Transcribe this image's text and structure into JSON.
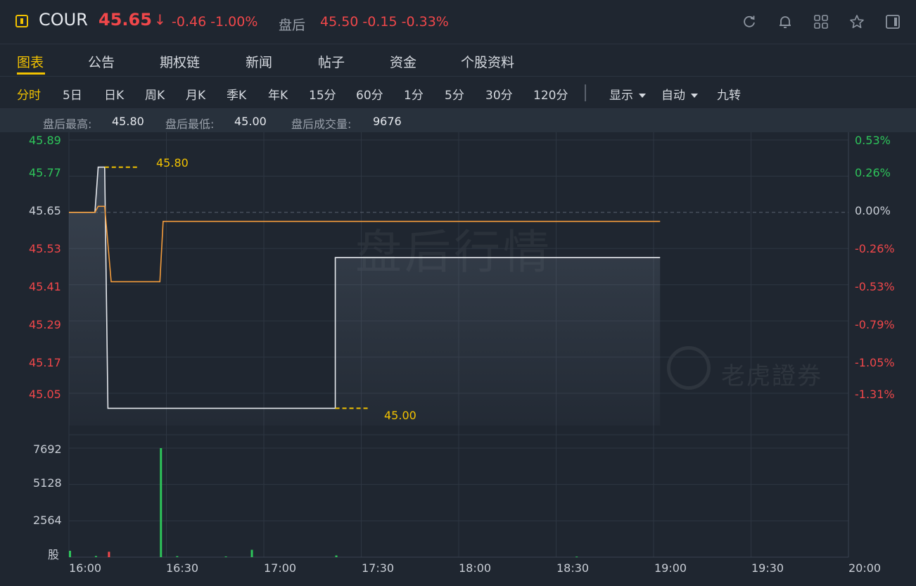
{
  "header": {
    "symbol": "COUR",
    "price": "45.65",
    "price_arrow": "↓",
    "change": "-0.46 -1.00%",
    "after_hours_label": "盘后",
    "after_hours_values": "45.50 -0.15 -0.33%",
    "icons": [
      "refresh-icon",
      "bell-icon",
      "grid-icon",
      "star-icon",
      "panel-toggle-icon"
    ]
  },
  "tabs": [
    {
      "label": "图表",
      "active": true
    },
    {
      "label": "公告"
    },
    {
      "label": "期权链"
    },
    {
      "label": "新闻"
    },
    {
      "label": "帖子"
    },
    {
      "label": "资金"
    },
    {
      "label": "个股资料"
    }
  ],
  "periods": [
    "分时",
    "5日",
    "日K",
    "周K",
    "月K",
    "季K",
    "年K",
    "15分",
    "60分",
    "1分",
    "5分",
    "30分",
    "120分"
  ],
  "period_active": "分时",
  "display_menu": "显示",
  "auto_menu": "自动",
  "nine_turn": "九转",
  "stats": {
    "high_label": "盘后最高:",
    "high": "45.80",
    "low_label": "盘后最低:",
    "low": "45.00",
    "vol_label": "盘后成交量:",
    "vol": "9676"
  },
  "price_axis": [
    "45.89",
    "45.77",
    "45.65",
    "45.53",
    "45.41",
    "45.29",
    "45.17",
    "45.05"
  ],
  "pct_axis": [
    "0.53%",
    "0.26%",
    "0.00%",
    "-0.26%",
    "-0.53%",
    "-0.79%",
    "-1.05%",
    "-1.31%"
  ],
  "volume_axis": [
    "7692",
    "5128",
    "2564",
    "股"
  ],
  "time_axis": [
    "16:00",
    "16:30",
    "17:00",
    "17:30",
    "18:00",
    "18:30",
    "19:00",
    "19:30",
    "20:00"
  ],
  "annotations": {
    "max": "45.80",
    "min": "45.00"
  },
  "watermarks": {
    "main": "盘后行情",
    "brand": "老虎證券"
  },
  "colors": {
    "up": "#2ec45a",
    "down": "#f0474a",
    "accent": "#f2c200",
    "avg_line": "#f39c3c",
    "price_line": "#e6e9ee"
  },
  "chart_data": {
    "type": "line",
    "x_range": [
      "16:00",
      "20:00"
    ],
    "y_range": [
      45.05,
      45.89
    ],
    "prev_close": 45.65,
    "price_series": [
      {
        "t": "16:00",
        "v": 45.65
      },
      {
        "t": "16:08",
        "v": 45.65
      },
      {
        "t": "16:09",
        "v": 45.8
      },
      {
        "t": "16:11",
        "v": 45.8
      },
      {
        "t": "16:12",
        "v": 45.0
      },
      {
        "t": "17:22",
        "v": 45.0
      },
      {
        "t": "17:22",
        "v": 45.5
      },
      {
        "t": "19:02",
        "v": 45.5
      }
    ],
    "avg_series": [
      {
        "t": "16:00",
        "v": 45.65
      },
      {
        "t": "16:08",
        "v": 45.65
      },
      {
        "t": "16:09",
        "v": 45.67
      },
      {
        "t": "16:11",
        "v": 45.67
      },
      {
        "t": "16:13",
        "v": 45.42
      },
      {
        "t": "16:28",
        "v": 45.42
      },
      {
        "t": "16:29",
        "v": 45.62
      },
      {
        "t": "17:30",
        "v": 45.62
      },
      {
        "t": "19:02",
        "v": 45.62
      }
    ],
    "volume_range": [
      0,
      7692
    ],
    "volume_bars": [
      {
        "t": "16:00",
        "v": 450,
        "dir": "up"
      },
      {
        "t": "16:08",
        "v": 80,
        "dir": "up"
      },
      {
        "t": "16:12",
        "v": 380,
        "dir": "down"
      },
      {
        "t": "16:28",
        "v": 7692,
        "dir": "up"
      },
      {
        "t": "16:33",
        "v": 70,
        "dir": "up"
      },
      {
        "t": "16:48",
        "v": 50,
        "dir": "up"
      },
      {
        "t": "16:56",
        "v": 520,
        "dir": "up"
      },
      {
        "t": "17:22",
        "v": 120,
        "dir": "up"
      },
      {
        "t": "18:36",
        "v": 40,
        "dir": "up"
      }
    ]
  }
}
